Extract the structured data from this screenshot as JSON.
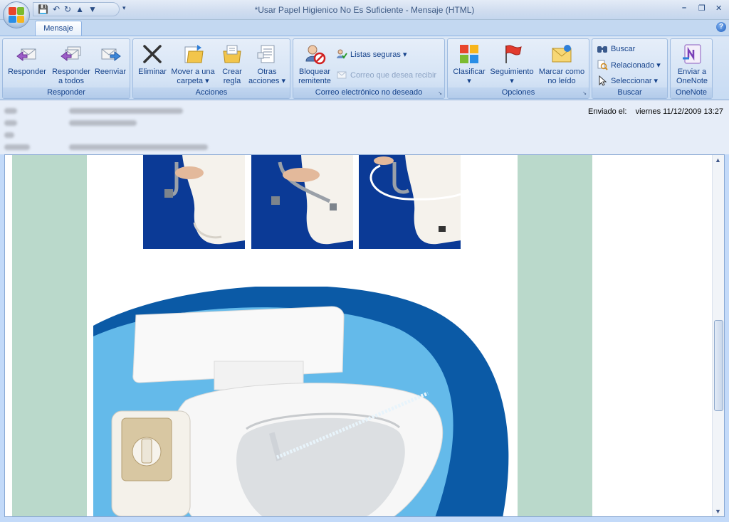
{
  "window": {
    "title": "*Usar Papel Higienico No Es Suficiente - Mensaje (HTML)",
    "minimize": "–",
    "restore": "❐",
    "close": "✕"
  },
  "qat": {
    "more": "▾"
  },
  "tabs": [
    {
      "label": "Mensaje",
      "active": true
    }
  ],
  "help": "?",
  "ribbon": {
    "groups": [
      {
        "label": "Responder",
        "buttons": [
          {
            "label": "Responder",
            "icon": "reply-icon"
          },
          {
            "label": "Responder a todos",
            "line1": "Responder",
            "line2": "a todos",
            "icon": "reply-all-icon"
          },
          {
            "label": "Reenviar",
            "icon": "forward-icon"
          }
        ]
      },
      {
        "label": "Acciones",
        "buttons": [
          {
            "label": "Eliminar",
            "icon": "delete-icon"
          },
          {
            "line1": "Mover a una",
            "line2": "carpeta ▾",
            "icon": "move-folder-icon"
          },
          {
            "line1": "Crear",
            "line2": "regla",
            "icon": "create-rule-icon"
          },
          {
            "line1": "Otras",
            "line2": "acciones ▾",
            "icon": "other-actions-icon"
          }
        ]
      },
      {
        "label": "Correo electrónico no deseado",
        "buttons": [
          {
            "line1": "Bloquear",
            "line2": "remitente",
            "icon": "block-sender-icon"
          },
          {
            "label": "Listas seguras ▾",
            "icon": "safe-lists-icon"
          },
          {
            "label": "Correo que desea recibir",
            "icon": "not-junk-icon",
            "disabled": true
          }
        ]
      },
      {
        "label": "Opciones",
        "buttons": [
          {
            "line1": "Clasificar",
            "line2": "▾",
            "icon": "categorize-icon"
          },
          {
            "line1": "Seguimiento",
            "line2": "▾",
            "icon": "follow-up-flag-icon"
          },
          {
            "line1": "Marcar como",
            "line2": "no leído",
            "icon": "mark-unread-icon"
          }
        ]
      },
      {
        "label": "Buscar",
        "buttons": [
          {
            "label": "Buscar",
            "icon": "find-icon"
          },
          {
            "label": "Relacionado ▾",
            "icon": "related-icon"
          },
          {
            "label": "Seleccionar ▾",
            "icon": "select-icon"
          }
        ]
      },
      {
        "label": "OneNote",
        "buttons": [
          {
            "line1": "Enviar a",
            "line2": "OneNote",
            "icon": "onenote-icon"
          }
        ]
      }
    ]
  },
  "header": {
    "sent_label": "Enviado el:",
    "sent_value": "viernes 11/12/2009 13:27"
  },
  "colors": {
    "ribbon_bg": "#c7dbf3",
    "side_green": "#bad9cb",
    "image_blue": "#0b3a96"
  }
}
